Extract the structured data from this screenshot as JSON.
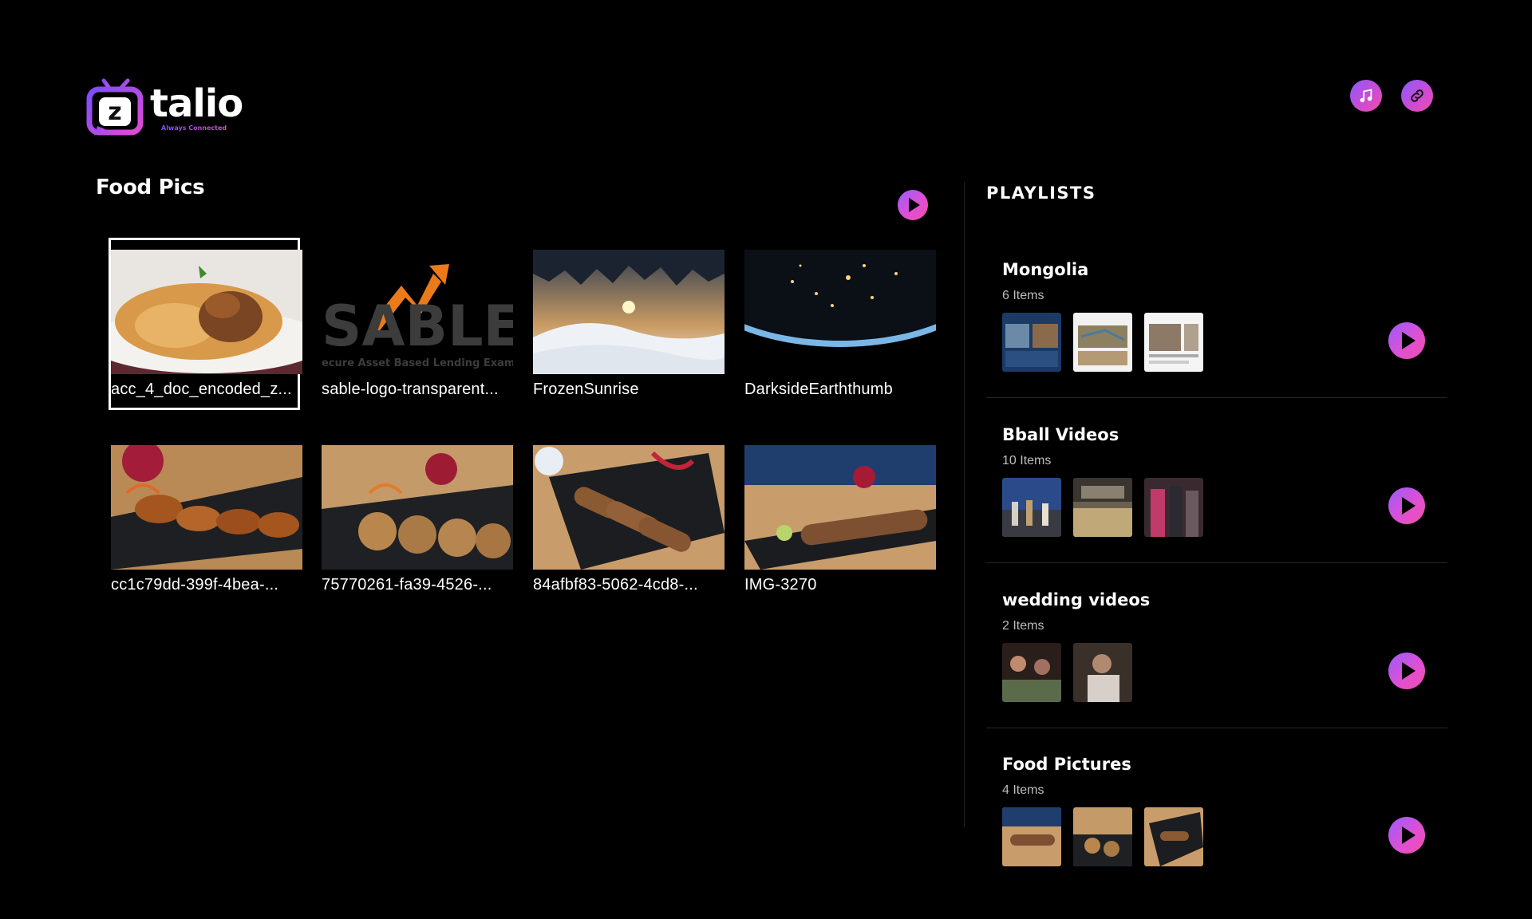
{
  "app": {
    "logo_text": "talio",
    "logo_tagline": "Always Connected",
    "brand_gradient": [
      "#7b4dff",
      "#e04bd0",
      "#f04fa8"
    ]
  },
  "header": {
    "music_icon": "music-note-icon",
    "link_icon": "link-icon"
  },
  "album": {
    "title": "Food Pics",
    "play_icon": "play-icon",
    "items": [
      {
        "caption": "acc_4_doc_encoded_z...",
        "thumb": "biryani-plate"
      },
      {
        "caption": "sable-logo-transparent...",
        "thumb": "sable-logo"
      },
      {
        "caption": "FrozenSunrise",
        "thumb": "ice-cave-sunrise"
      },
      {
        "caption": "DarksideEarththumb",
        "thumb": "earth-night"
      },
      {
        "caption": "cc1c79dd-399f-4bea-...",
        "thumb": "grilled-shrimp"
      },
      {
        "caption": "75770261-fa39-4526-...",
        "thumb": "patties-plate"
      },
      {
        "caption": "84afbf83-5062-4cd8-...",
        "thumb": "kebab-plate"
      },
      {
        "caption": "IMG-3270",
        "thumb": "roll-plate"
      }
    ]
  },
  "playlists": {
    "heading": "PLAYLISTS",
    "items": [
      {
        "name": "Mongolia",
        "count": "6 Items"
      },
      {
        "name": "Bball Videos",
        "count": "10 Items"
      },
      {
        "name": "wedding videos",
        "count": "2 Items"
      },
      {
        "name": "Food Pictures",
        "count": "4 Items"
      }
    ]
  }
}
